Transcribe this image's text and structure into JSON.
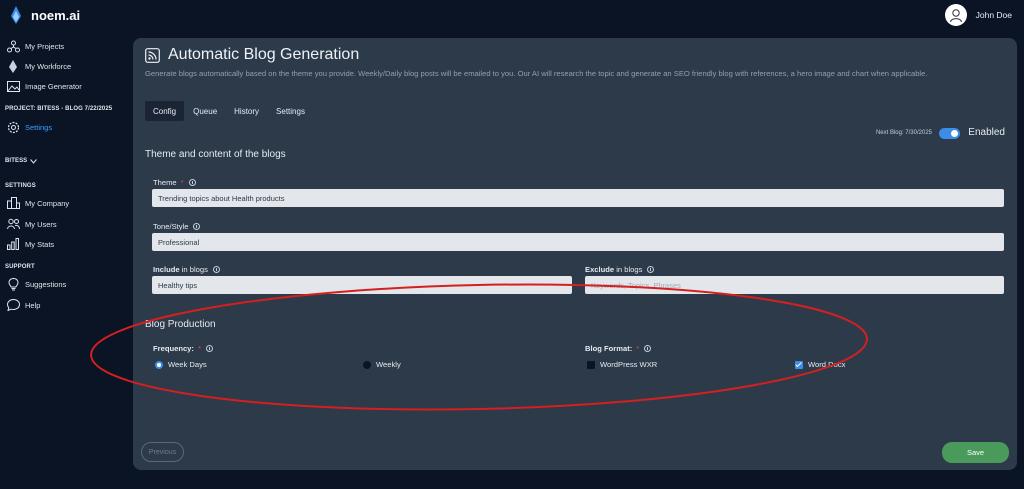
{
  "app": {
    "brand": "noem.ai"
  },
  "user": {
    "name": "John Doe"
  },
  "sidebar": {
    "nav": [
      {
        "label": "My Projects",
        "icon": "projects-icon"
      },
      {
        "label": "My Workforce",
        "icon": "workforce-icon"
      },
      {
        "label": "Image Generator",
        "icon": "image-icon"
      }
    ],
    "project_heading": "PROJECT: BITESS - BLOG 7/22/2025",
    "project_settings": "Settings",
    "account_dropdown": "BITESS",
    "settings_heading": "SETTINGS",
    "settings_items": [
      "My Company",
      "My Users",
      "My Stats"
    ],
    "support_heading": "SUPPORT",
    "support_items": [
      "Suggestions",
      "Help"
    ]
  },
  "page": {
    "title": "Automatic Blog Generation",
    "description": "Generate blogs automatically based on the theme you provide. Weekly/Daily blog posts will be emailed to you. Our AI will research the topic and generate an SEO friendly blog with references, a hero image and chart when applicable.",
    "tabs": [
      {
        "label": "Config",
        "active": true
      },
      {
        "label": "Queue",
        "active": false
      },
      {
        "label": "History",
        "active": false
      },
      {
        "label": "Settings",
        "active": false
      }
    ],
    "next_blog": "Next Blog: 7/30/2025",
    "enabled_label": "Enabled",
    "enabled": true
  },
  "theme_section": {
    "title": "Theme and content of the blogs",
    "theme_label": "Theme",
    "theme_value": "Trending topics about Health products",
    "tone_label": "Tone/Style",
    "tone_value": "Professional",
    "include_bold": "Include",
    "include_rest": " in blogs",
    "include_value": "Healthy tips",
    "exclude_bold": "Exclude",
    "exclude_rest": " in blogs",
    "exclude_placeholder": "Keywords, Topics, Phrases"
  },
  "production": {
    "title": "Blog Production",
    "frequency_label": "Frequency:",
    "frequency_options": [
      {
        "label": "Week Days",
        "selected": true
      },
      {
        "label": "Weekly",
        "selected": false
      }
    ],
    "format_label": "Blog Format:",
    "format_options": [
      {
        "label": "WordPress WXR",
        "checked": false
      },
      {
        "label": "Word Docx",
        "checked": true
      }
    ]
  },
  "actions": {
    "previous": "Previous",
    "save": "Save"
  },
  "colors": {
    "background": "#0b1424",
    "panel": "#2d3a4a",
    "accent": "#3b8de6",
    "save": "#4a9a5c",
    "required": "#e34a4a",
    "annotation": "#d42020"
  }
}
